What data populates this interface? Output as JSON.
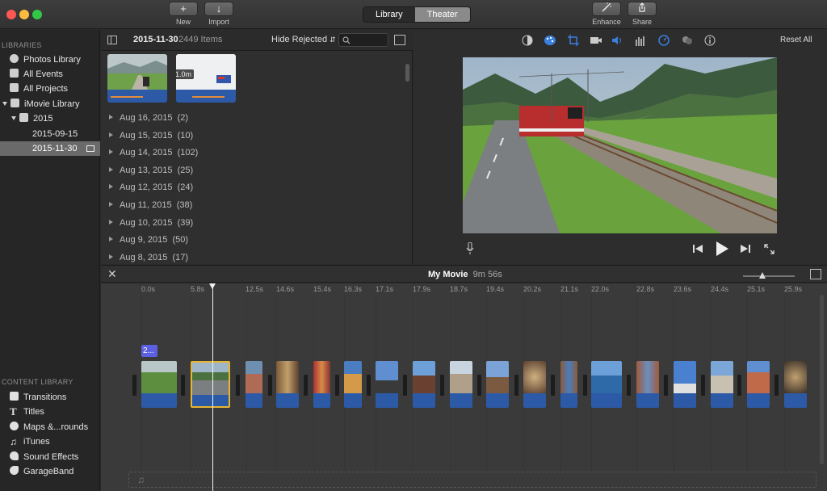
{
  "toolbar": {
    "new_label": "New",
    "import_label": "Import",
    "library_tab": "Library",
    "theater_tab": "Theater",
    "enhance_label": "Enhance",
    "share_label": "Share"
  },
  "sidebar": {
    "libraries_header": "LIBRARIES",
    "items": [
      {
        "label": "Photos Library"
      },
      {
        "label": "All Events"
      },
      {
        "label": "All Projects"
      },
      {
        "label": "iMovie Library"
      },
      {
        "label": "2015"
      },
      {
        "label": "2015-09-15"
      },
      {
        "label": "2015-11-30"
      }
    ],
    "content_header": "CONTENT LIBRARY",
    "content_items": [
      {
        "label": "Transitions"
      },
      {
        "label": "Titles"
      },
      {
        "label": "Maps &...rounds"
      },
      {
        "label": "iTunes"
      },
      {
        "label": "Sound Effects"
      },
      {
        "label": "GarageBand"
      }
    ]
  },
  "browser": {
    "event_name": "2015-11-30",
    "item_count": "2449 Items",
    "filter": "Hide Rejected",
    "thumb_duration": "1.0m",
    "events": [
      {
        "date": "Aug 16, 2015",
        "count": "(2)"
      },
      {
        "date": "Aug 15, 2015",
        "count": "(10)"
      },
      {
        "date": "Aug 14, 2015",
        "count": "(102)"
      },
      {
        "date": "Aug 13, 2015",
        "count": "(25)"
      },
      {
        "date": "Aug 12, 2015",
        "count": "(24)"
      },
      {
        "date": "Aug 11, 2015",
        "count": "(38)"
      },
      {
        "date": "Aug 10, 2015",
        "count": "(39)"
      },
      {
        "date": "Aug 9, 2015",
        "count": "(50)"
      },
      {
        "date": "Aug 8, 2015",
        "count": "(17)"
      }
    ]
  },
  "viewer": {
    "reset_all": "Reset All"
  },
  "timeline": {
    "project_title": "My Movie",
    "duration": "9m 56s",
    "title_badge": "2...",
    "ticks": [
      "0.0s",
      "5.8s",
      "12.5s",
      "14.6s",
      "15.4s",
      "16.3s",
      "17.1s",
      "17.9s",
      "18.7s",
      "19.4s",
      "20.2s",
      "21.1s",
      "22.0s",
      "22.8s",
      "23.6s",
      "24.4s",
      "25.1s",
      "25.9s"
    ]
  },
  "colors": {
    "accent_blue": "#2d5aa6",
    "selection_yellow": "#e7b530",
    "title_purple": "#5b5fe0"
  }
}
